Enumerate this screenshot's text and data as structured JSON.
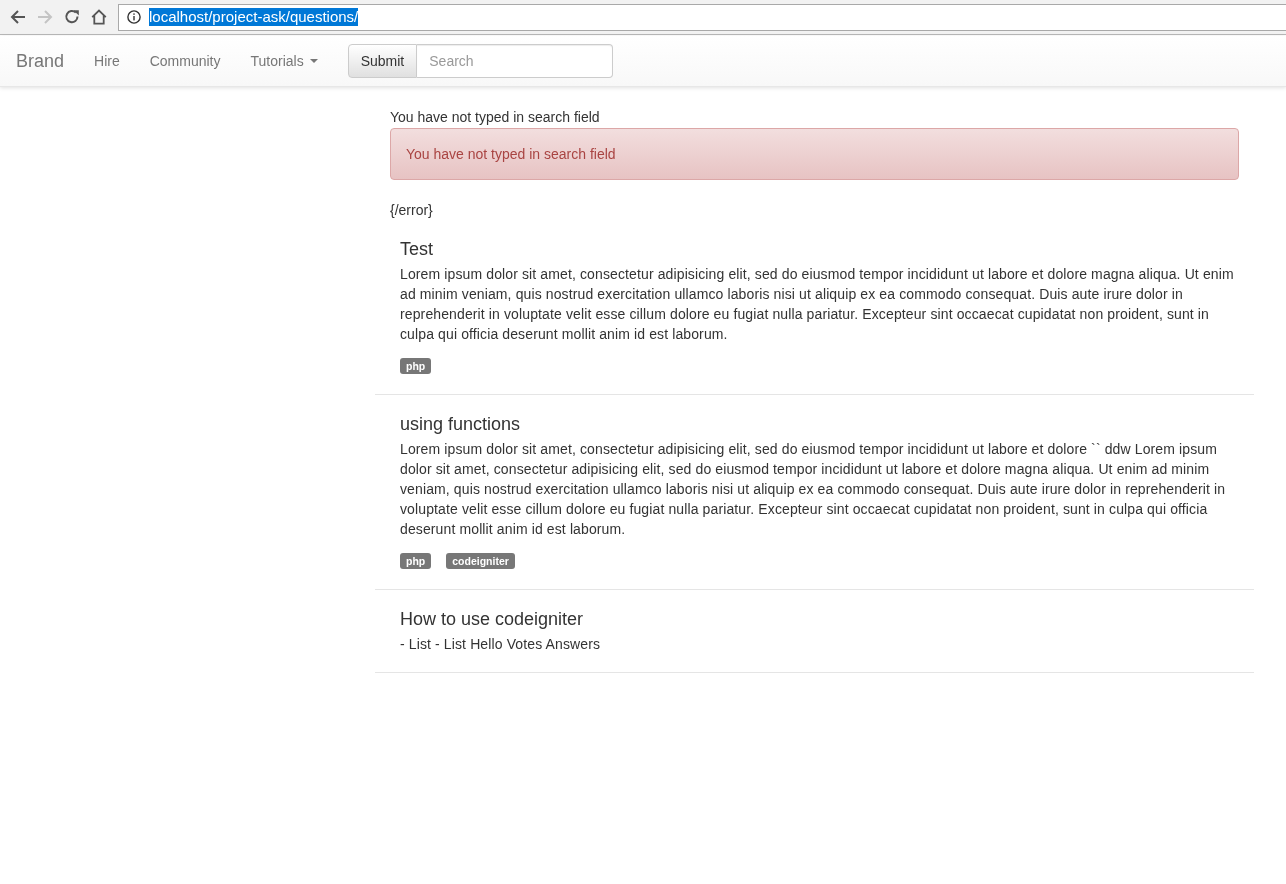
{
  "browser": {
    "url": "localhost/project-ask/questions/",
    "url_selected": true,
    "forward_disabled": true
  },
  "navbar": {
    "brand": "Brand",
    "links": [
      {
        "label": "Hire",
        "kind": "link"
      },
      {
        "label": "Community",
        "kind": "link"
      },
      {
        "label": "Tutorials",
        "kind": "dropdown"
      }
    ],
    "search": {
      "button": "Submit",
      "placeholder": "Search"
    }
  },
  "messages": {
    "notice": "You have not typed in search field",
    "alert": "You have not typed in search field",
    "trailing": "{/error}"
  },
  "questions": [
    {
      "title": "Test",
      "body": "Lorem ipsum dolor sit amet, consectetur adipisicing elit, sed do eiusmod tempor incididunt ut labore et dolore magna aliqua. Ut enim ad minim veniam, quis nostrud exercitation ullamco laboris nisi ut aliquip ex ea commodo consequat. Duis aute irure dolor in reprehenderit in voluptate velit esse cillum dolore eu fugiat nulla pariatur. Excepteur sint occaecat cupidatat non proident, sunt in culpa qui officia deserunt mollit anim id est laborum.",
      "tags": [
        "php"
      ]
    },
    {
      "title": "using functions",
      "body": "Lorem ipsum dolor sit amet, consectetur adipisicing elit, sed do eiusmod tempor incididunt ut labore et dolore `` ddw Lorem ipsum dolor sit amet, consectetur adipisicing elit, sed do eiusmod tempor incididunt ut labore et dolore magna aliqua. Ut enim ad minim veniam, quis nostrud exercitation ullamco laboris nisi ut aliquip ex ea commodo consequat. Duis aute irure dolor in reprehenderit in voluptate velit esse cillum dolore eu fugiat nulla pariatur. Excepteur sint occaecat cupidatat non proident, sunt in culpa qui officia deserunt mollit anim id est laborum.",
      "tags": [
        "php",
        "codeigniter"
      ]
    },
    {
      "title": "How to use codeigniter",
      "body": "- List - List Hello Votes Answers"
    }
  ]
}
